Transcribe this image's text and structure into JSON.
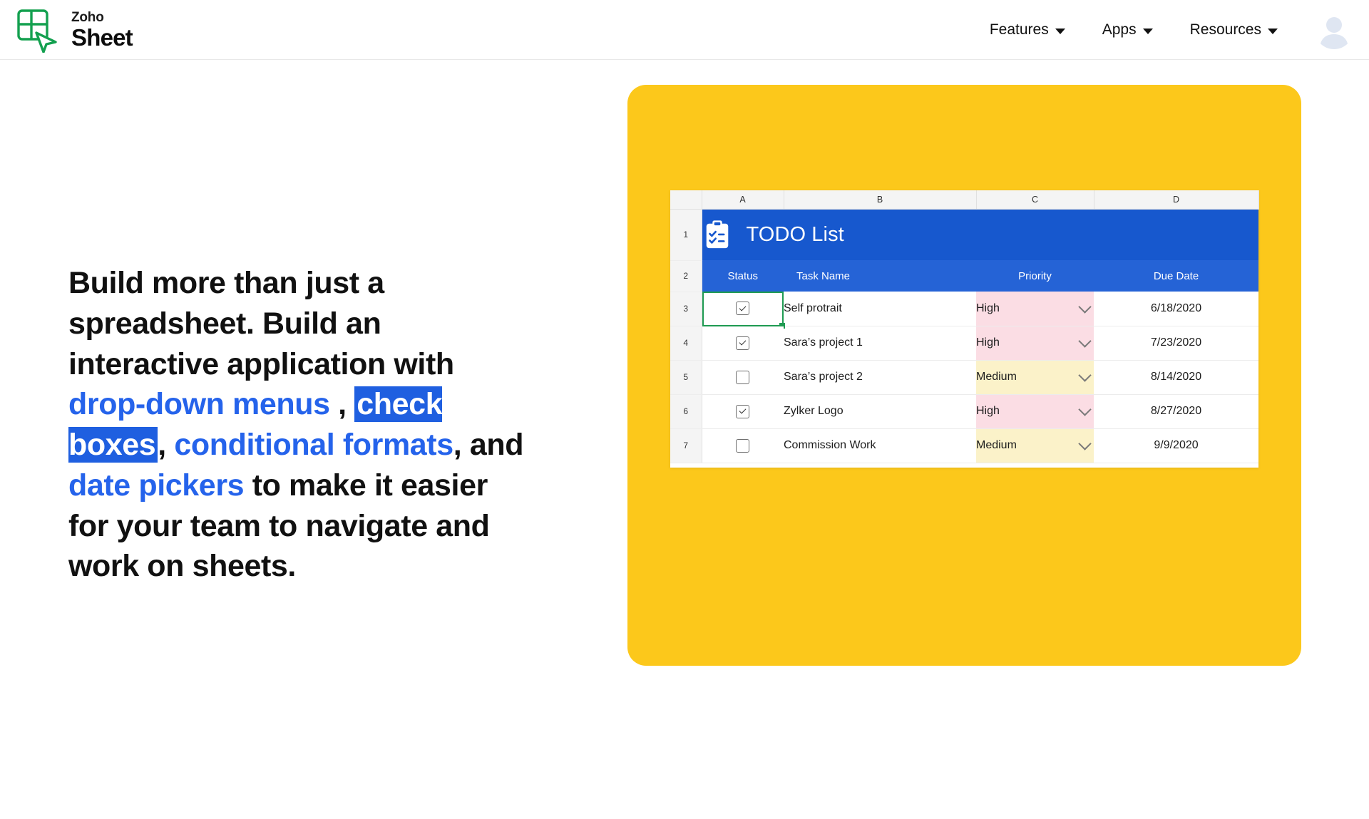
{
  "brand": {
    "logo_icon": "zoho-sheet-logo-icon",
    "name_top": "Zoho",
    "name_bottom": "Sheet"
  },
  "nav": {
    "items": [
      {
        "label": "Features",
        "icon": "chevron-down-icon"
      },
      {
        "label": "Apps",
        "icon": "chevron-down-icon"
      },
      {
        "label": "Resources",
        "icon": "chevron-down-icon"
      }
    ],
    "avatar_icon": "user-avatar-icon"
  },
  "hero": {
    "headline_parts": [
      {
        "text": "Build more than just a spreadsheet. Build an interactive application with ",
        "style": "plain"
      },
      {
        "text": "drop-down menus",
        "style": "link"
      },
      {
        "text": " , ",
        "style": "plain"
      },
      {
        "text": "check boxes",
        "style": "mark"
      },
      {
        "text": ", ",
        "style": "plain"
      },
      {
        "text": "conditional formats",
        "style": "link"
      },
      {
        "text": ", and ",
        "style": "plain"
      },
      {
        "text": "date pickers",
        "style": "link"
      },
      {
        "text": " to make it easier for your team to navigate and work on sheets.",
        "style": "plain"
      }
    ]
  },
  "colors": {
    "card_yellow": "#fcc81b",
    "header_blue": "#1758ce",
    "subheader_blue": "#2563d6",
    "link_blue": "#2563eb",
    "highlight_blue": "#1f5fe0",
    "priority_high_bg": "#fbdde4",
    "priority_medium_bg": "#fbf2c9",
    "selection_green": "#1f9b52",
    "brand_green": "#13a04f"
  },
  "spreadsheet": {
    "column_letters": [
      "A",
      "B",
      "C",
      "D"
    ],
    "title": {
      "icon": "clipboard-checklist-icon",
      "text": "TODO List",
      "row_number": "1"
    },
    "header": {
      "row_number": "2",
      "columns": [
        "Status",
        "Task Name",
        "Priority",
        "Due Date"
      ]
    },
    "selected_cell": "A3",
    "rows": [
      {
        "row_number": "3",
        "checked": true,
        "task": "Self protrait",
        "priority": "High",
        "priority_level": "high",
        "due_date": "6/18/2020",
        "dropdown_icon": "chevron-down-icon",
        "checkbox_icon": "checkbox-checked-icon"
      },
      {
        "row_number": "4",
        "checked": true,
        "task": "Sara’s project 1",
        "priority": "High",
        "priority_level": "high",
        "due_date": "7/23/2020",
        "dropdown_icon": "chevron-down-icon",
        "checkbox_icon": "checkbox-checked-icon"
      },
      {
        "row_number": "5",
        "checked": false,
        "task": "Sara’s project 2",
        "priority": "Medium",
        "priority_level": "medium",
        "due_date": "8/14/2020",
        "dropdown_icon": "chevron-down-icon",
        "checkbox_icon": "checkbox-unchecked-icon"
      },
      {
        "row_number": "6",
        "checked": true,
        "task": "Zylker Logo",
        "priority": "High",
        "priority_level": "high",
        "due_date": "8/27/2020",
        "dropdown_icon": "chevron-down-icon",
        "checkbox_icon": "checkbox-checked-icon"
      },
      {
        "row_number": "7",
        "checked": false,
        "task": "Commission Work",
        "priority": "Medium",
        "priority_level": "medium",
        "due_date": "9/9/2020",
        "dropdown_icon": "chevron-down-icon",
        "checkbox_icon": "checkbox-unchecked-icon"
      }
    ]
  }
}
